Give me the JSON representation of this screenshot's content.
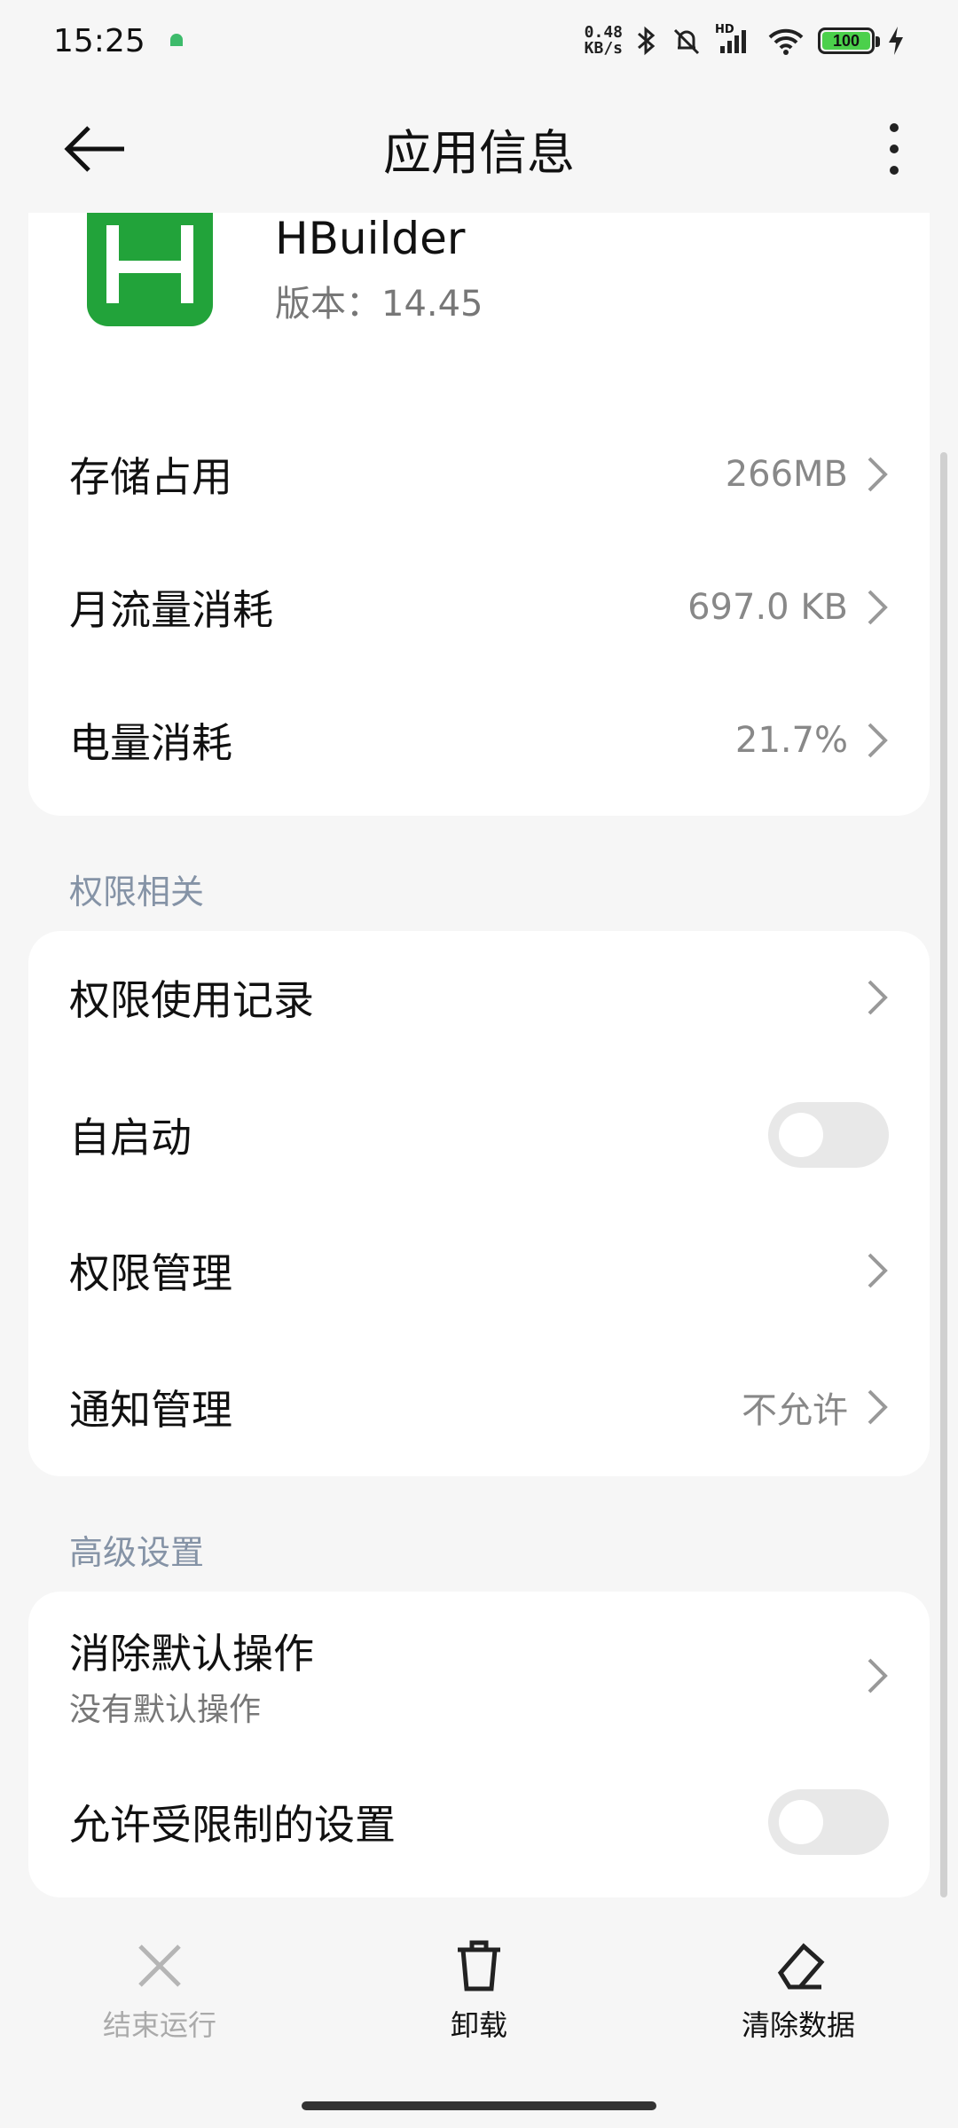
{
  "status_bar": {
    "time": "15:25",
    "net_speed_value": "0.48",
    "net_speed_unit": "KB/s",
    "signal_label": "HD",
    "battery_level": "100"
  },
  "header": {
    "title": "应用信息"
  },
  "app": {
    "name": "HBuilder",
    "version": "版本：14.45",
    "icon_letter": "H",
    "icon_color": "#22a33a"
  },
  "usage_rows": [
    {
      "label": "存储占用",
      "value": "266MB"
    },
    {
      "label": "月流量消耗",
      "value": "697.0 KB"
    },
    {
      "label": "电量消耗",
      "value": "21.7%"
    }
  ],
  "permissions_section": {
    "label": "权限相关",
    "rows": [
      {
        "label": "权限使用记录"
      },
      {
        "label": "自启动",
        "toggle": false
      },
      {
        "label": "权限管理"
      },
      {
        "label": "通知管理",
        "value": "不允许"
      }
    ]
  },
  "advanced_section": {
    "label": "高级设置",
    "clear_defaults": {
      "label": "消除默认操作",
      "sub": "没有默认操作"
    },
    "restricted_settings": {
      "label": "允许受限制的设置",
      "toggle": false
    }
  },
  "bottom_actions": [
    {
      "label": "结束运行",
      "icon": "close-icon",
      "enabled": false
    },
    {
      "label": "卸载",
      "icon": "trash-icon",
      "enabled": true
    },
    {
      "label": "清除数据",
      "icon": "eraser-icon",
      "enabled": true
    }
  ]
}
